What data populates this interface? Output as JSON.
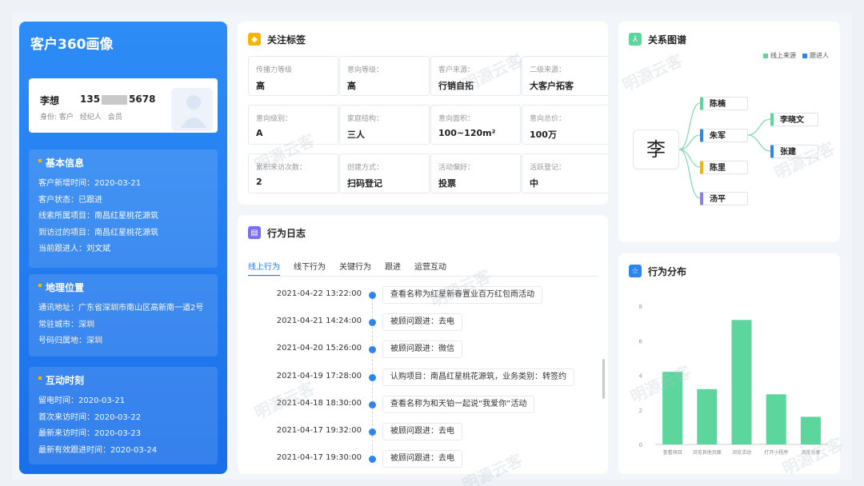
{
  "customer": {
    "panel_title": "客户360画像",
    "name": "李想",
    "phone_prefix": "135",
    "phone_suffix": "5678",
    "meta": [
      "身份: 客户",
      "经纪人",
      "会员"
    ]
  },
  "basic_info": {
    "title": "基本信息",
    "rows": [
      "客户新增时间：2020-03-21",
      "客户状态：已跟进",
      "线索所属项目：南昌红星桃花源筑",
      "到访过的项目：南昌红星桃花源筑",
      "当前跟进人：刘文斌"
    ]
  },
  "geo": {
    "title": "地理位置",
    "rows": [
      "通讯地址：广东省深圳市南山区高新南一道2号",
      "常驻城市：深圳",
      "号码归属地：深圳"
    ]
  },
  "interaction": {
    "title": "互动时刻",
    "rows": [
      "留电时间：2020-03-21",
      "首次来访时间：2020-03-22",
      "最新来访时间：2020-03-23",
      "最新有效跟进时间：2020-03-24"
    ]
  },
  "tags": {
    "title": "关注标签",
    "items": [
      {
        "label": "传播力等级",
        "value": "高"
      },
      {
        "label": "意向等级：",
        "value": "高"
      },
      {
        "label": "客户来源：",
        "value": "行销自拓"
      },
      {
        "label": "二级来源：",
        "value": "大客户拓客"
      },
      {
        "label": "意向级别：",
        "value": "A"
      },
      {
        "label": "家庭结构：",
        "value": "三人"
      },
      {
        "label": "意向面积：",
        "value": "100~120m²"
      },
      {
        "label": "意向总价：",
        "value": "100万"
      },
      {
        "label": "累积来访次数：",
        "value": "2"
      },
      {
        "label": "创建方式：",
        "value": "扫码登记"
      },
      {
        "label": "活动偏好：",
        "value": "投票"
      },
      {
        "label": "活跃登记：",
        "value": "中"
      }
    ]
  },
  "behavior": {
    "title": "行为日志",
    "tabs": [
      "线上行为",
      "线下行为",
      "关键行为",
      "跟进",
      "运营互动"
    ],
    "logs": [
      {
        "time": "2021-04-22 13:22:00",
        "text": "查看名称为红星新春置业百万红包雨活动"
      },
      {
        "time": "2021-04-21 14:24:00",
        "text": "被顾问跟进：去电"
      },
      {
        "time": "2021-04-20 15:26:00",
        "text": "被顾问跟进：微信"
      },
      {
        "time": "2021-04-19 17:28:00",
        "text": "认购项目：南昌红星桃花源筑，业务类别：转签约"
      },
      {
        "time": "2021-04-18 18:30:00",
        "text": "查看名称为和天铂一起说“我爱你”活动"
      },
      {
        "time": "2021-04-17 19:32:00",
        "text": "被顾问跟进：去电"
      },
      {
        "time": "2021-04-17 19:30:00",
        "text": "被顾问跟进：去电"
      }
    ]
  },
  "relation": {
    "title": "关系图谱",
    "center": "李",
    "legend": [
      {
        "name": "线上来源",
        "color": "#5dd69e"
      },
      {
        "name": "跟进人",
        "color": "#2b86f2"
      }
    ],
    "nodes": [
      {
        "name": "陈楠",
        "color": "#5dd69e"
      },
      {
        "name": "朱军",
        "color": "#2b86f2"
      },
      {
        "name": "陈里",
        "color": "#f7b500"
      },
      {
        "name": "汤平",
        "color": "#8c7cf0"
      },
      {
        "name": "李晓文",
        "color": "#5dd69e"
      },
      {
        "name": "张建",
        "color": "#2b86f2"
      }
    ]
  },
  "distribution": {
    "title": "行为分布"
  },
  "watermark": "明源云客",
  "colors": {
    "primary": "#1f78f0",
    "green": "#5dd69e",
    "orange": "#f7b500",
    "purple": "#8c7cf0"
  },
  "chart_data": {
    "type": "bar",
    "categories": [
      "查看项目",
      "浏览其他页面",
      "浏览活动",
      "打开小程序",
      "浏览分享"
    ],
    "values": [
      4.2,
      3.2,
      7.2,
      2.9,
      1.6
    ],
    "ylim": [
      0,
      8
    ],
    "yticks": [
      0,
      2,
      4,
      6,
      8
    ],
    "grid": false,
    "color": "#5dd69e"
  }
}
